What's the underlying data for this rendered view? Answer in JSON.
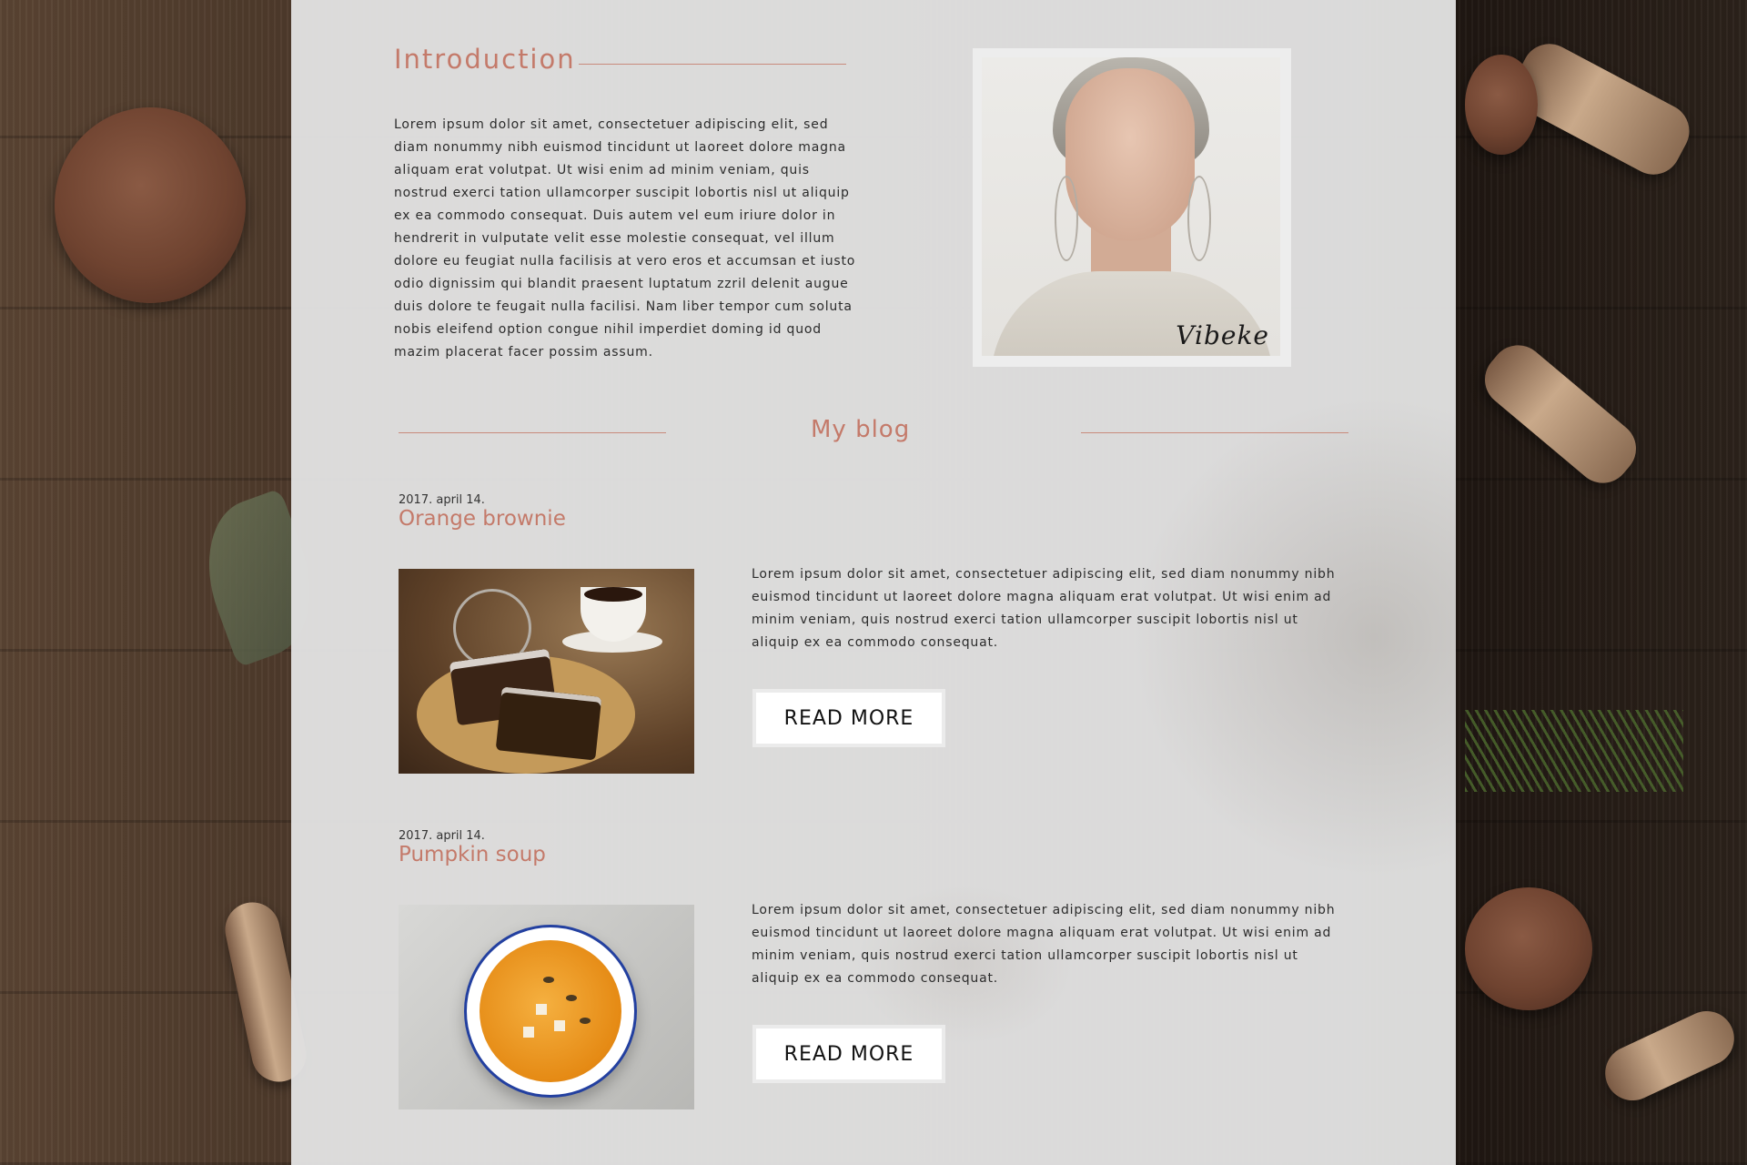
{
  "intro": {
    "title": "Introduction",
    "text": "Lorem ipsum dolor sit amet, consectetuer adipiscing elit, sed diam nonummy nibh euismod tincidunt ut laoreet dolore magna aliquam erat volutpat. Ut wisi enim ad minim veniam, quis nostrud exerci tation ullamcorper suscipit lobortis nisl ut aliquip ex ea commodo consequat. Duis autem vel eum iriure dolor in hendrerit in vulputate velit esse molestie consequat, vel illum dolore eu feugiat nulla facilisis at vero eros et accumsan et iusto odio dignissim qui blandit praesent luptatum zzril delenit augue duis dolore te feugait nulla facilisi. Nam liber tempor cum soluta nobis eleifend option congue nihil imperdiet doming id quod mazim placerat facer possim assum.",
    "portrait_signature": "Vibeke"
  },
  "blog": {
    "title": "My blog",
    "posts": [
      {
        "date": "2017. april 14.",
        "title": "Orange brownie",
        "excerpt": "Lorem ipsum dolor sit amet, consectetuer adipiscing elit, sed diam nonummy nibh euismod tincidunt ut laoreet dolore magna aliquam erat volutpat. Ut wisi enim ad minim veniam, quis nostrud exerci tation ullamcorper suscipit lobortis nisl ut aliquip ex ea commodo consequat.",
        "button": "READ MORE"
      },
      {
        "date": "2017. april 14.",
        "title": "Pumpkin soup",
        "excerpt": "Lorem ipsum dolor sit amet, consectetuer adipiscing elit, sed diam nonummy nibh euismod tincidunt ut laoreet dolore magna aliquam erat volutpat. Ut wisi enim ad minim veniam, quis nostrud exerci tation ullamcorper suscipit lobortis nisl ut aliquip ex ea commodo consequat.",
        "button": "READ MORE"
      }
    ]
  },
  "colors": {
    "accent": "#c47a6a",
    "panel": "#e2e2e2",
    "text": "#2b2b2b",
    "button_bg": "#ffffff"
  }
}
